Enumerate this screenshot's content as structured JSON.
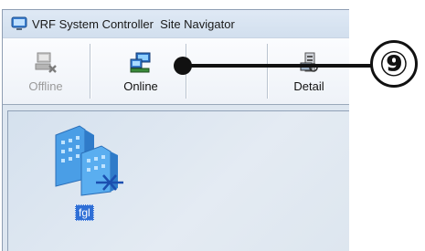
{
  "window": {
    "title": "VRF System Controller  Site Navigator",
    "icons": {
      "app": "monitor-icon"
    }
  },
  "toolbar": {
    "buttons": [
      {
        "label": "Offline",
        "icon": "computer-disconnect-icon",
        "enabled": false
      },
      {
        "label": "Online",
        "icon": "computer-connect-icon",
        "enabled": true
      },
      {
        "label": "Detail",
        "icon": "server-detail-icon",
        "enabled": true
      }
    ]
  },
  "site_navigator": {
    "sites": [
      {
        "name": "fgl",
        "icon": "building-offline-icon"
      }
    ]
  },
  "annotation": {
    "callout_number": "⑨",
    "callout_target": "Online"
  },
  "colors": {
    "selection": "#2f6fd6",
    "offline_mark": "#1b4fb0",
    "building": "#4a9ee6"
  }
}
